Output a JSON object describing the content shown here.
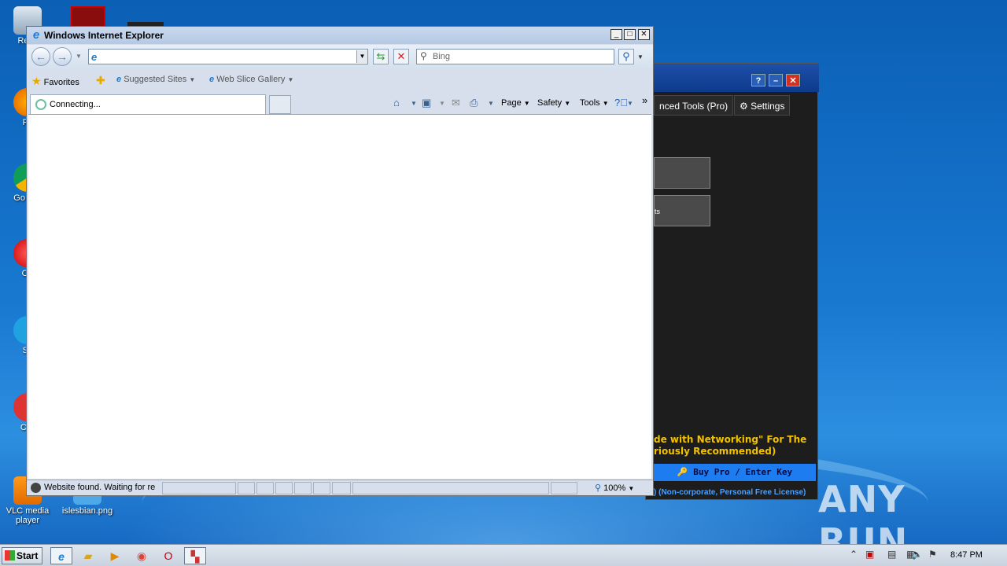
{
  "desktop": {
    "icons": [
      {
        "label": "Recy"
      },
      {
        "label": "Fir"
      },
      {
        "label": "Go\nChr"
      },
      {
        "label": "Op"
      },
      {
        "label": "Sk"
      },
      {
        "label": "CCl"
      },
      {
        "label": "VLC media player"
      },
      {
        "label": "islesbian.png"
      }
    ]
  },
  "bg_app": {
    "tabs": [
      "nced Tools (Pro)",
      "Settings"
    ],
    "button2_label": "ts",
    "warning_line1": "de with Networking\" For The",
    "warning_line2": "riously Recommended)",
    "buy_label": "Buy Pro / Enter Key",
    "license": ") (Non-corporate, Personal Free License)"
  },
  "ie": {
    "title": "Windows Internet Explorer",
    "address_value": "",
    "search_placeholder": "Bing",
    "favorites": {
      "label": "Favorites",
      "suggested": "Suggested Sites",
      "webslice": "Web Slice Gallery"
    },
    "tab_label": "Connecting...",
    "commands": {
      "page": "Page",
      "safety": "Safety",
      "tools": "Tools"
    },
    "status_text": "Website found. Waiting for re",
    "zoom": "100%"
  },
  "taskbar": {
    "start_label": "Start",
    "clock": "8:47 PM"
  },
  "watermark": "ANY RUN"
}
